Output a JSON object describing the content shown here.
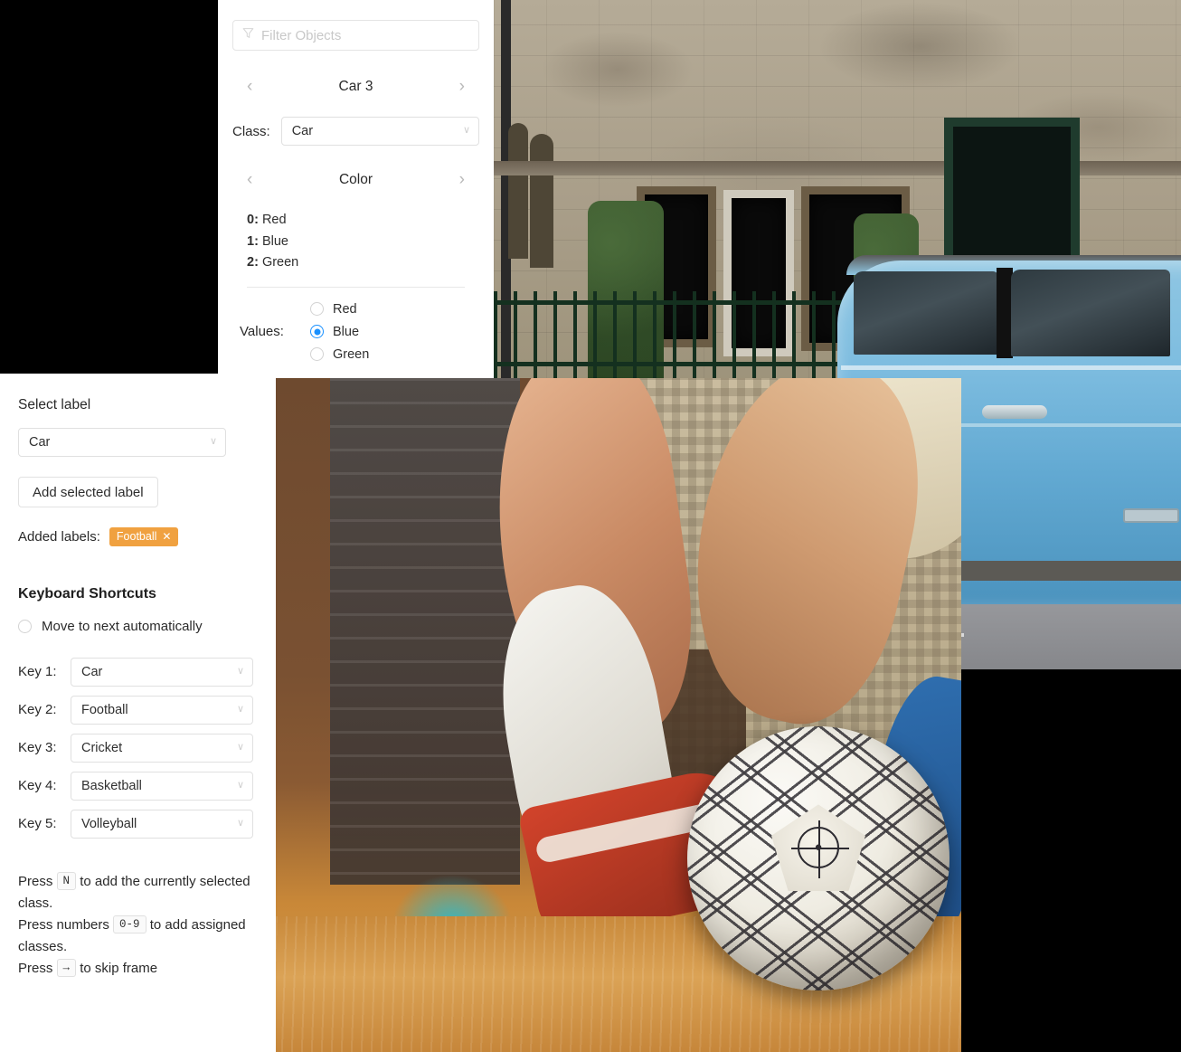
{
  "object_panel": {
    "filter": {
      "placeholder": "Filter Objects",
      "value": "",
      "icon": "filter-funnel-icon"
    },
    "object_nav": {
      "prev": "‹",
      "title": "Car 3",
      "next": "›"
    },
    "class_field": {
      "label": "Class:",
      "value": "Car",
      "caret": "∨"
    },
    "attribute_nav": {
      "prev": "‹",
      "title": "Color",
      "next": "›"
    },
    "enum_options": [
      {
        "index": "0:",
        "name": "Red"
      },
      {
        "index": "1:",
        "name": "Blue"
      },
      {
        "index": "2:",
        "name": "Green"
      }
    ],
    "values": {
      "label": "Values:",
      "options": [
        {
          "label": "Red",
          "selected": false
        },
        {
          "label": "Blue",
          "selected": true
        },
        {
          "label": "Green",
          "selected": false
        }
      ]
    }
  },
  "label_panel": {
    "select_label_title": "Select label",
    "select_label_value": "Car",
    "add_button": "Add selected label",
    "added_labels_title": "Added labels:",
    "added_labels": [
      {
        "name": "Football",
        "remove": "✕"
      }
    ],
    "shortcuts_title": "Keyboard Shortcuts",
    "move_next_label": "Move to next automatically",
    "move_next_checked": false,
    "keys": [
      {
        "label": "Key 1:",
        "value": "Car"
      },
      {
        "label": "Key 2:",
        "value": "Football"
      },
      {
        "label": "Key 3:",
        "value": "Cricket"
      },
      {
        "label": "Key 4:",
        "value": "Basketball"
      },
      {
        "label": "Key 5:",
        "value": "Volleyball"
      }
    ],
    "help": {
      "line1_before": "Press",
      "line1_key": "N",
      "line1_after": "to add the currently selected class.",
      "line2_before": "Press numbers",
      "line2_key": "0-9",
      "line2_after": "to add assigned classes.",
      "line3_before": "Press",
      "line3_key": "→",
      "line3_after": "to skip frame"
    }
  },
  "colors": {
    "accent_blue": "#1890ff",
    "tag_orange": "#f0a140",
    "panel_bg": "#ffffff",
    "backdrop": "#000000",
    "border": "#e2e2e2",
    "text": "#2a2a2a",
    "placeholder": "#c8c8c8"
  },
  "images": {
    "car_photo": {
      "alt": "light blue Fiat 500 parked beside an old stone building with sash windows, topiary hedges and green iron railings"
    },
    "football_photo": {
      "alt": "close up of a footballer's leg in white sock and red boot beside a classic white and black soccer ball on an orange pitch"
    }
  }
}
